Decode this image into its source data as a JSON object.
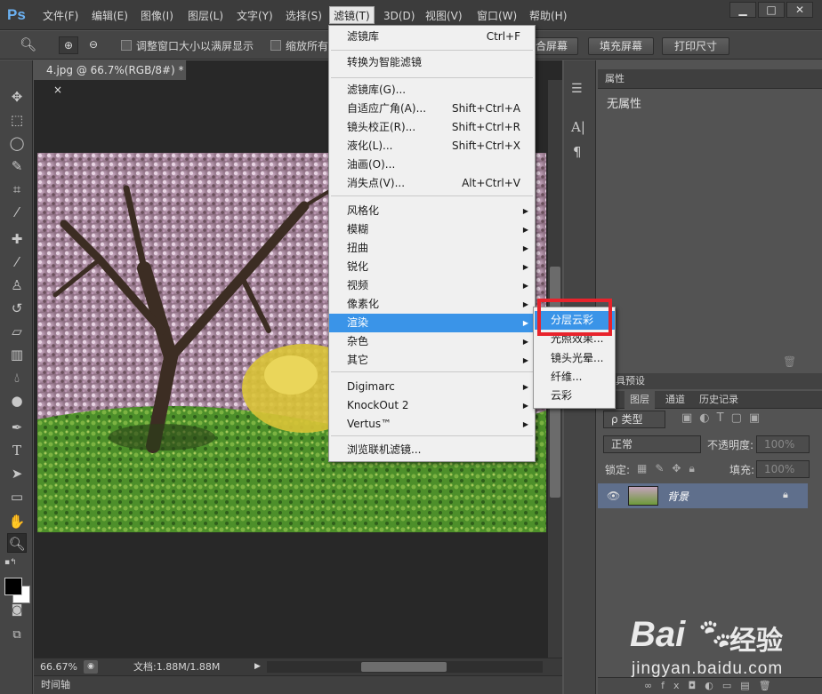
{
  "menubar": {
    "logo": "Ps",
    "items": [
      "文件(F)",
      "编辑(E)",
      "图像(I)",
      "图层(L)",
      "文字(Y)",
      "选择(S)",
      "滤镜(T)",
      "3D(D)",
      "视图(V)",
      "窗口(W)",
      "帮助(H)"
    ],
    "window_controls": [
      "▁",
      "□",
      "✕"
    ]
  },
  "optionsbar": {
    "resize_window_label": "调整窗口大小以满屏显示",
    "zoom_all_label": "缩放所有",
    "fit_screen_label": "合屏幕",
    "fill_screen_label": "填充屏幕",
    "print_size_label": "打印尺寸"
  },
  "document": {
    "tab_title": "4.jpg @ 66.7%(RGB/8#) *",
    "tab_close": "×",
    "zoom": "66.67%",
    "doc_info": "文档:1.88M/1.88M",
    "timeline_label": "时间轴"
  },
  "filter_menu": {
    "items": [
      {
        "label": "滤镜库",
        "shortcut": "Ctrl+F"
      },
      {
        "label": "转换为智能滤镜",
        "shortcut": ""
      },
      {
        "label": "滤镜库(G)...",
        "shortcut": ""
      },
      {
        "label": "自适应广角(A)...",
        "shortcut": "Shift+Ctrl+A"
      },
      {
        "label": "镜头校正(R)...",
        "shortcut": "Shift+Ctrl+R"
      },
      {
        "label": "液化(L)...",
        "shortcut": "Shift+Ctrl+X"
      },
      {
        "label": "油画(O)...",
        "shortcut": ""
      },
      {
        "label": "消失点(V)...",
        "shortcut": "Alt+Ctrl+V"
      },
      {
        "label": "风格化",
        "shortcut": ""
      },
      {
        "label": "模糊",
        "shortcut": ""
      },
      {
        "label": "扭曲",
        "shortcut": ""
      },
      {
        "label": "锐化",
        "shortcut": ""
      },
      {
        "label": "视频",
        "shortcut": ""
      },
      {
        "label": "像素化",
        "shortcut": ""
      },
      {
        "label": "渲染",
        "shortcut": ""
      },
      {
        "label": "杂色",
        "shortcut": ""
      },
      {
        "label": "其它",
        "shortcut": ""
      },
      {
        "label": "Digimarc",
        "shortcut": ""
      },
      {
        "label": "KnockOut 2",
        "shortcut": ""
      },
      {
        "label": "Vertus™",
        "shortcut": ""
      },
      {
        "label": "浏览联机滤镜...",
        "shortcut": ""
      }
    ]
  },
  "render_submenu": {
    "items": [
      "分层云彩",
      "光照效果...",
      "镜头光晕...",
      "纤维...",
      "云彩"
    ]
  },
  "properties_panel": {
    "title": "属性",
    "content": "无属性"
  },
  "layers_panel": {
    "presets_tab": "具预设",
    "tabs": [
      "图层",
      "通道",
      "历史记录"
    ],
    "kind_filter": "类型",
    "blend_mode": "正常",
    "opacity_label": "不透明度:",
    "opacity_value": "100%",
    "lock_label": "锁定:",
    "fill_label": "填充:",
    "fill_value": "100%",
    "layer_name": "背景"
  },
  "watermark": {
    "brand": "Bai",
    "brand_suffix": "经验",
    "url": "jingyan.baidu.com"
  },
  "colors": {
    "menu_highlight": "#3a94e8",
    "annotation_red": "#e8232c",
    "ps_blue": "#6bb1f2"
  }
}
